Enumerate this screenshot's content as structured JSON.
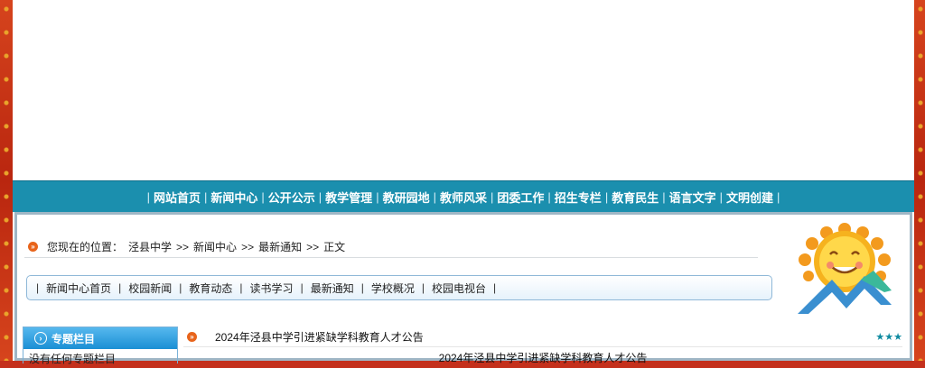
{
  "nav": {
    "items": [
      "网站首页",
      "新闻中心",
      "公开公示",
      "教学管理",
      "教研园地",
      "教师风采",
      "团委工作",
      "招生专栏",
      "教育民生",
      "语言文字",
      "文明创建"
    ]
  },
  "breadcrumb": {
    "prefix": "您现在的位置：",
    "items": [
      "泾县中学",
      "新闻中心",
      "最新通知",
      "正文"
    ],
    "separator": ">>"
  },
  "subnav": {
    "items": [
      "新闻中心首页",
      "校园新闻",
      "教育动态",
      "读书学习",
      "最新通知",
      "学校概况",
      "校园电视台"
    ]
  },
  "sidebar": {
    "title": "专题栏目",
    "empty_text": "没有任何专题栏目"
  },
  "article": {
    "title": "2024年泾县中学引进紧缺学科教育人才公告",
    "rating": "★★★",
    "heading": "2024年泾县中学引进紧缺学科教育人才公告"
  },
  "colors": {
    "nav_bg": "#1b8fae",
    "bullet": "#e8641b",
    "frame": "#c4301c"
  }
}
